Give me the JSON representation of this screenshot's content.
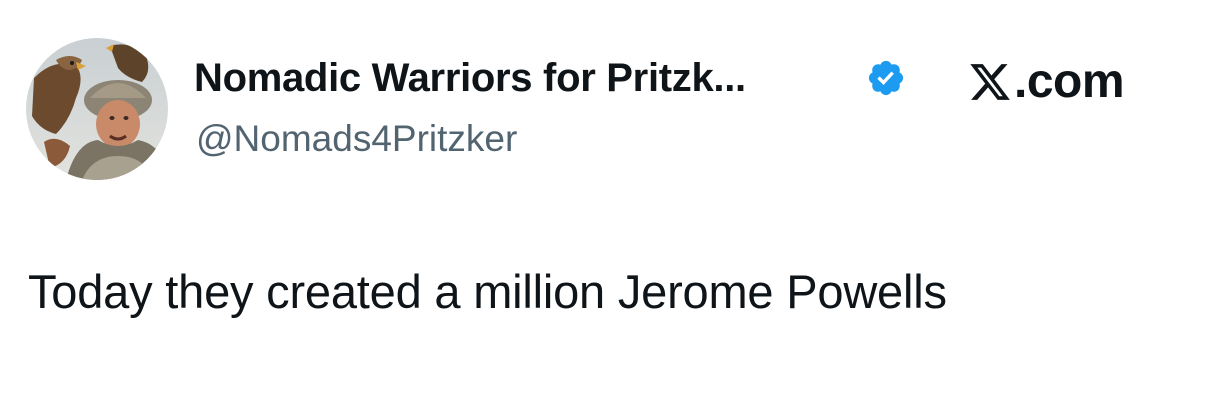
{
  "tweet": {
    "author": {
      "display_name": "Nomadic Warriors for Pritzk...",
      "handle": "@Nomads4Pritzker",
      "verified": true,
      "verified_badge_color": "#1d9bf0",
      "avatar_icon": "avatar-warrior-with-eagle"
    },
    "brand": {
      "logo_icon": "x-logo-icon",
      "label": ".com"
    },
    "text": "Today they created a million Jerome Powells"
  },
  "colors": {
    "text_primary": "#0f1419",
    "text_secondary": "#536471",
    "background": "#ffffff"
  }
}
